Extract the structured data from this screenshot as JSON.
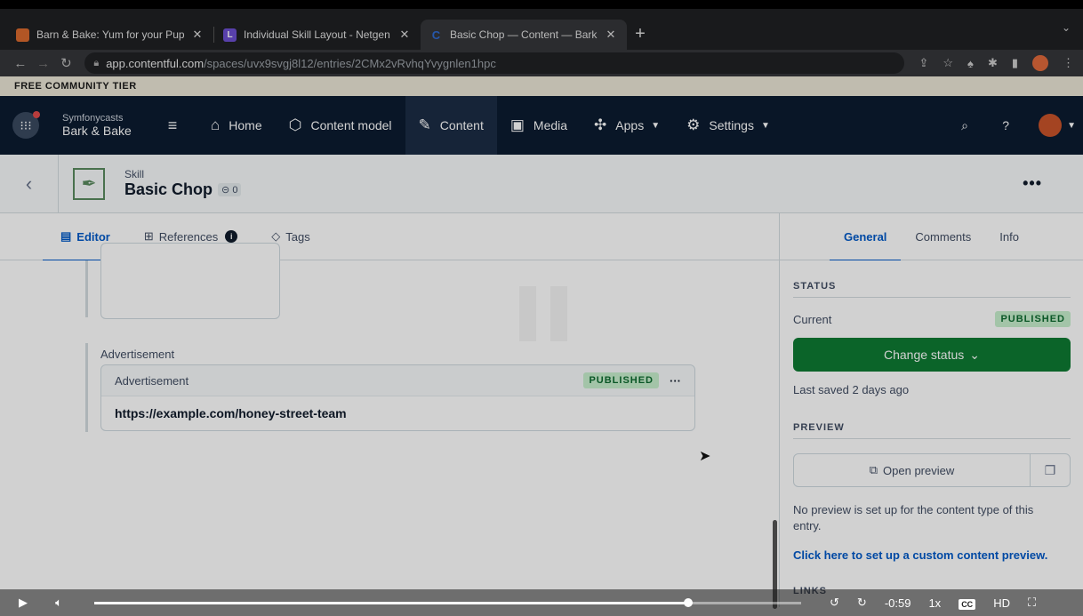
{
  "browser": {
    "tabs": [
      {
        "title": "Barn & Bake: Yum for your Pup",
        "close": "✕",
        "fav_color": "#d96a2e",
        "active": false
      },
      {
        "title": "Individual Skill Layout - Netgen",
        "close": "✕",
        "fav_color": "#6c4fd1",
        "active": false
      },
      {
        "title": "Basic Chop — Content — Bark",
        "close": "✕",
        "fav_color": "#2f6bd1",
        "active": true
      }
    ],
    "new_tab": "+",
    "url_host": "app.contentful.com",
    "url_path": "/spaces/uvx9svgj8l12/entries/2CMx2vRvhqYvygnlen1hpc"
  },
  "tier": "FREE COMMUNITY TIER",
  "nav": {
    "org": "Symfonycasts",
    "space": "Bark & Bake",
    "items": [
      {
        "label": "Home",
        "icon": "home-icon"
      },
      {
        "label": "Content model",
        "icon": "cube-icon"
      },
      {
        "label": "Content",
        "icon": "edit-icon"
      },
      {
        "label": "Media",
        "icon": "image-icon"
      },
      {
        "label": "Apps",
        "icon": "puzzle-icon"
      },
      {
        "label": "Settings",
        "icon": "gear-icon"
      }
    ]
  },
  "entry": {
    "type": "Skill",
    "title": "Basic Chop",
    "link_count": "0"
  },
  "editor_tabs": {
    "editor": "Editor",
    "references": "References",
    "tags": "Tags",
    "info_badge": "i"
  },
  "sidebar_tabs": {
    "general": "General",
    "comments": "Comments",
    "info": "Info"
  },
  "editor": {
    "field_label": "Advertisement",
    "card_type": "Advertisement",
    "card_status": "PUBLISHED",
    "card_title": "https://example.com/honey-street-team"
  },
  "sidebar": {
    "status_heading": "STATUS",
    "current_label": "Current",
    "current_status": "PUBLISHED",
    "change_status": "Change status",
    "last_saved": "Last saved 2 days ago",
    "preview_heading": "PREVIEW",
    "open_preview": "Open preview",
    "no_preview": "No preview is set up for the content type of this entry.",
    "setup_link": "Click here to set up a custom content preview.",
    "links_heading": "LINKS"
  },
  "video": {
    "time_remaining": "-0:59",
    "speed": "1x",
    "cc": "CC",
    "quality": "HD",
    "progress": 0.84
  }
}
